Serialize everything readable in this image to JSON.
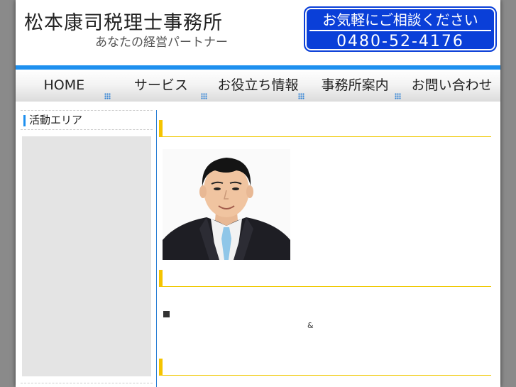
{
  "header": {
    "title": "松本康司税理士事務所",
    "subtitle": "あなたの経営パートナー",
    "contact_cta": "お気軽にご相談ください",
    "phone": "0480-52-4176"
  },
  "nav": {
    "items": [
      {
        "label": "HOME"
      },
      {
        "label": "サービス"
      },
      {
        "label": "お役立ち情報"
      },
      {
        "label": "事務所案内"
      },
      {
        "label": "お問い合わせ"
      }
    ]
  },
  "sidebar": {
    "heading": "活動エリア"
  },
  "main": {
    "ampersand": "&"
  },
  "colors": {
    "nav_blue": "#1e90ef",
    "contact_bg": "#0a3fd8",
    "heading_accent": "#f5c400"
  }
}
